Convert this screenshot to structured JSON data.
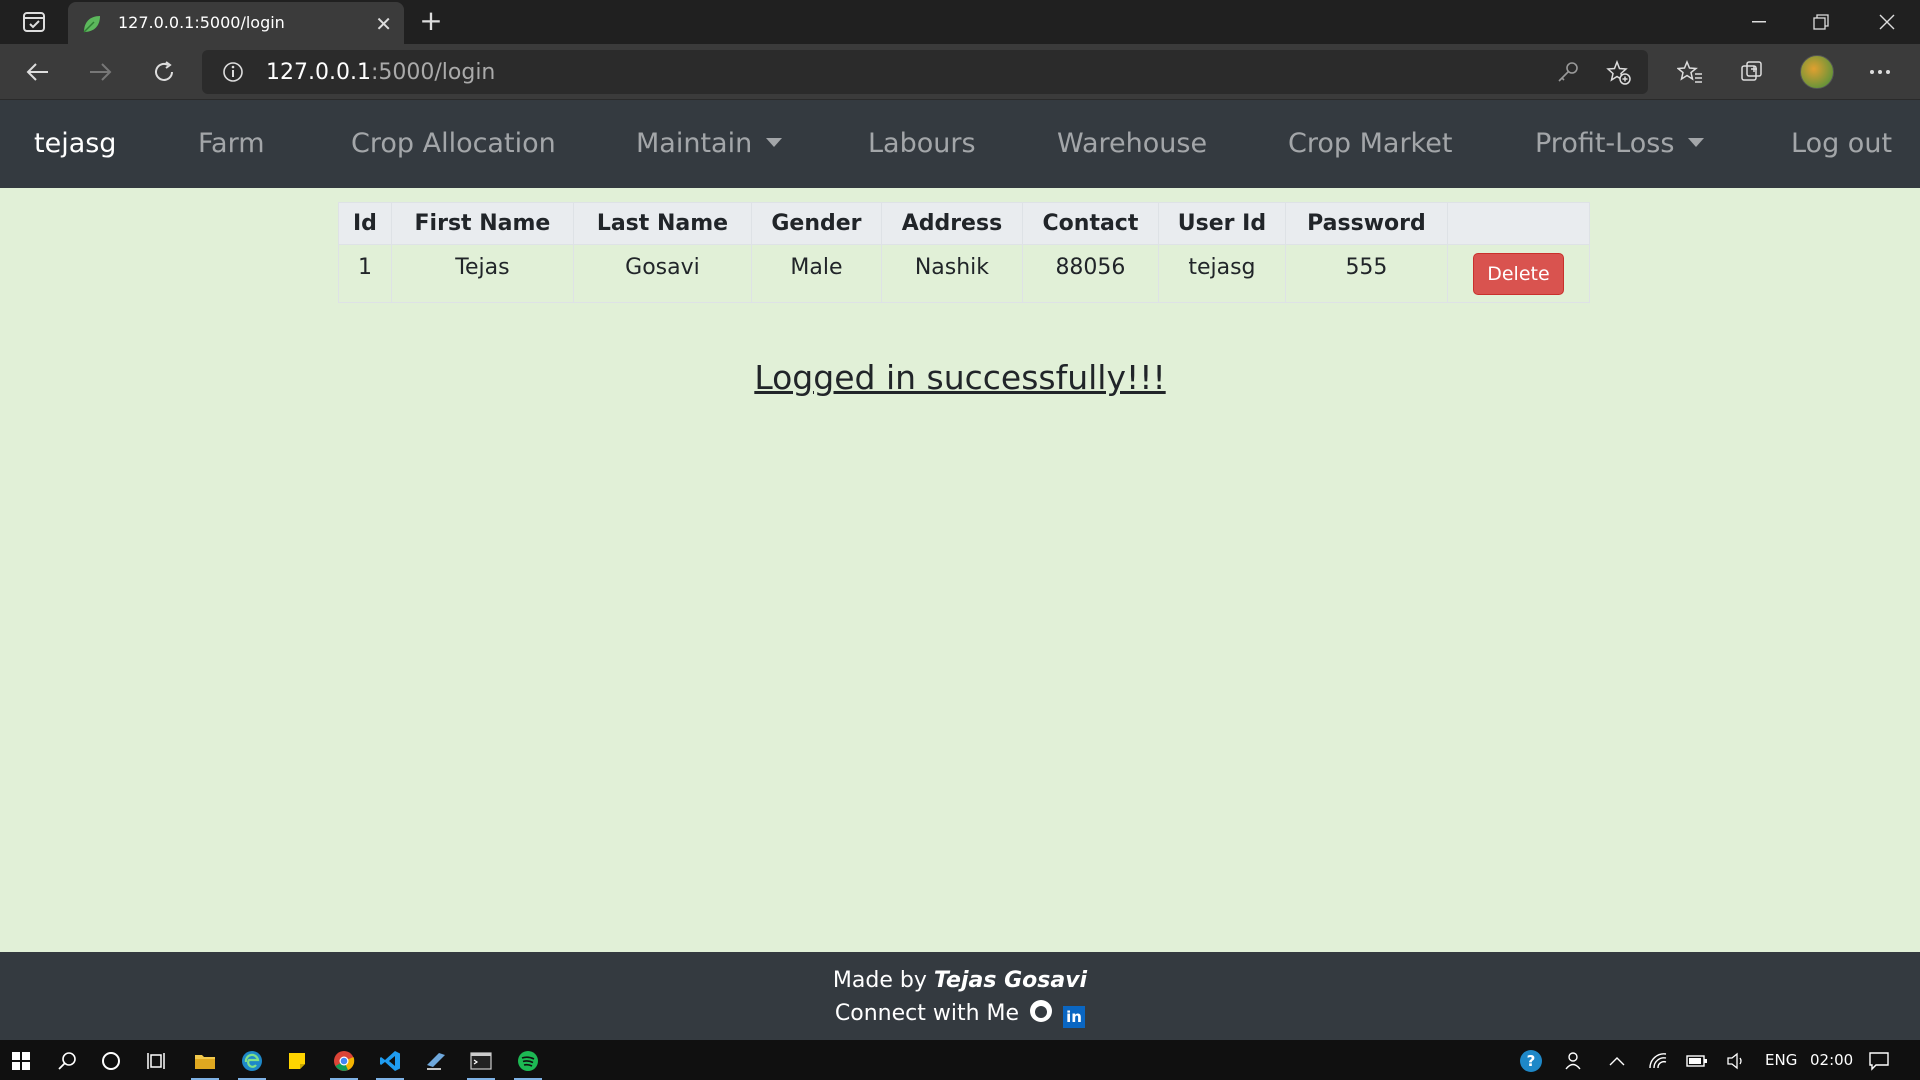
{
  "browser": {
    "tab_title": "127.0.0.1:5000/login",
    "new_tab_symbol": "+",
    "url_host": "127.0.0.1",
    "url_path": ":5000/login"
  },
  "navbar": {
    "brand": "tejasg",
    "links": [
      "Farm",
      "Crop Allocation",
      "Maintain",
      "Labours",
      "Warehouse",
      "Crop Market",
      "Profit-Loss",
      "Log out"
    ]
  },
  "table": {
    "headers": [
      "Id",
      "First Name",
      "Last Name",
      "Gender",
      "Address",
      "Contact",
      "User Id",
      "Password",
      ""
    ],
    "rows": [
      {
        "id": "1",
        "first_name": "Tejas",
        "last_name": "Gosavi",
        "gender": "Male",
        "address": "Nashik",
        "contact": "88056",
        "user_id": "tejasg",
        "password": "555",
        "action": "Delete"
      }
    ]
  },
  "message": "Logged in successfully!!!",
  "footer": {
    "made_by_prefix": "Made by",
    "author": "Tejas Gosavi",
    "connect": "Connect with Me",
    "linkedin_glyph": "in"
  },
  "taskbar": {
    "language": "ENG",
    "time": "02:00"
  },
  "colors": {
    "page_bg": "#e1f0d7",
    "navbar_bg": "#343a40",
    "delete_btn": "#d9534f"
  }
}
